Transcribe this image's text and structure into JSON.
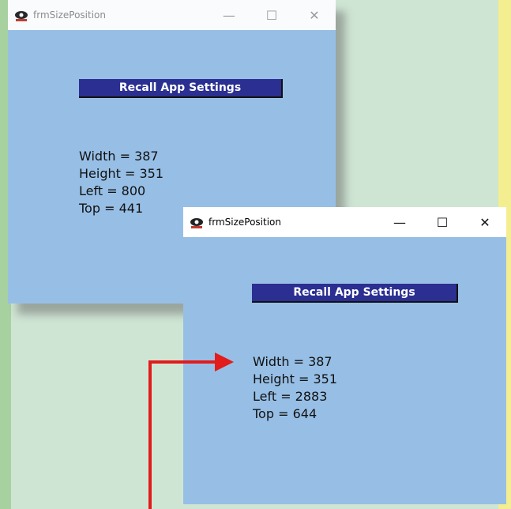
{
  "window_back": {
    "title": "frmSizePosition",
    "button_label": "Recall App Settings",
    "info": [
      "Width = 387",
      "Height = 351",
      "Left = 800",
      "Top = 441"
    ],
    "controls": [
      "—",
      "☐",
      "✕"
    ]
  },
  "window_front": {
    "title": "frmSizePosition",
    "button_label": "Recall App Settings",
    "info": [
      "Width = 387",
      "Height = 351",
      "Left = 2883",
      "Top = 644"
    ],
    "controls": [
      "—",
      "☐",
      "✕"
    ]
  },
  "colors": {
    "window_bg": "#97bfe6",
    "button_bg": "#2b2f91",
    "arrow": "#e21b1b"
  }
}
